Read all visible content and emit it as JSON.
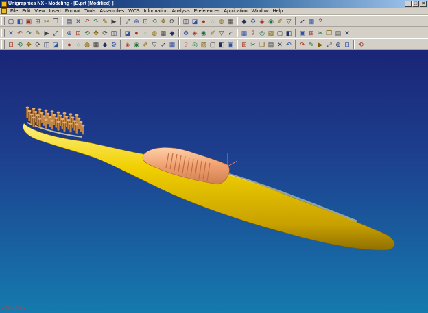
{
  "window": {
    "title": "Unigraphics NX - Modeling - [B.prt (Modified) ]",
    "controls": {
      "minimize": "_",
      "maximize": "□",
      "close": "×"
    }
  },
  "menubar": {
    "items": [
      "File",
      "Edit",
      "View",
      "Insert",
      "Format",
      "Tools",
      "Assemblies",
      "WCS",
      "Information",
      "Analysis",
      "Preferences",
      "Application",
      "Window",
      "Help"
    ]
  },
  "toolbars": {
    "row1": [
      "new-icon",
      "open-icon",
      "save-icon",
      "print-icon",
      "cut-icon",
      "copy-icon",
      "paste-icon",
      "delete-icon",
      "undo-icon",
      "redo-icon",
      "edit-icon",
      "play-icon",
      "fit-icon",
      "zoom-icon",
      "zoom-window-icon",
      "rotate-icon",
      "pan-icon",
      "refresh-icon",
      "snap-view-icon",
      "perspective-icon",
      "shaded-icon",
      "wireframe-icon",
      "hidden-icon",
      "layer-icon",
      "color-icon",
      "settings-icon",
      "model-icon",
      "assembly-icon",
      "sketch-icon",
      "filter-icon",
      "select-icon",
      "grid-icon",
      "help-icon"
    ],
    "row2": [
      "block-icon",
      "cylinder-icon",
      "cone-icon",
      "sphere-icon",
      "extrude-icon",
      "revolve-icon",
      "sweep-icon",
      "hole-icon",
      "boss-icon",
      "pocket-icon",
      "pad-icon",
      "slot-icon",
      "groove-icon",
      "blend-icon",
      "chamfer-icon",
      "shell-icon",
      "draft-icon",
      "pattern-icon",
      "mirror-icon",
      "unite-icon",
      "subtract-icon",
      "intersect-icon",
      "trim-icon",
      "split-icon",
      "offset-icon",
      "scale-icon",
      "thicken-icon",
      "sew-icon",
      "patch-icon",
      "edit-feature-icon",
      "suppress-icon",
      "unsuppress-icon",
      "replace-icon",
      "reorder-icon",
      "parameters-icon",
      "expressions-icon"
    ],
    "row3": [
      "point-icon",
      "line-icon",
      "arc-icon",
      "spline-icon",
      "plus-icon",
      "rectangle-icon",
      "polygon-icon",
      "ellipse-icon",
      "helix-icon",
      "offset-curve-icon",
      "bridge-icon",
      "project-icon",
      "intersect-curve-icon",
      "section-icon",
      "extract-icon",
      "join-icon",
      "divide-icon",
      "fillet-curve-icon",
      "trim-curve-icon",
      "edit-curve-icon",
      "through-curves-icon",
      "mesh-icon",
      "swept-icon",
      "ruled-icon",
      "bounded-plane-icon",
      "n-sided-icon",
      "law-icon",
      "fillet-surface-icon",
      "offset-surface-icon",
      "extension-icon",
      "isoparametric-icon",
      "curve-analysis-icon",
      "surface-analysis-icon",
      "deviation-icon",
      "reflection-icon",
      "draft-analysis-icon",
      "settings2-icon"
    ]
  },
  "viewport": {
    "status_text": "COPY ONLY",
    "colors": {
      "bg_top": "#1a2577",
      "bg_bottom": "#157aae",
      "handle": "#f0d000",
      "grip": "#f0a070",
      "bristles": "#b87a3a"
    }
  }
}
